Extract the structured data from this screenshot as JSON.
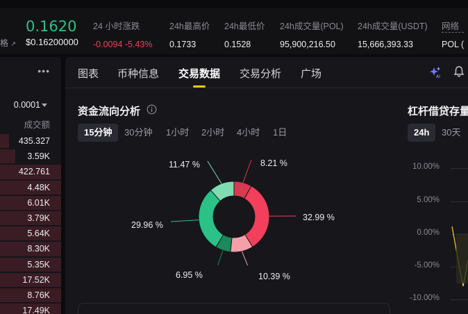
{
  "ticker": {
    "price": "0.1620",
    "price_usd": "$0.16200000",
    "left_cut_text": "格",
    "stats": [
      {
        "label": "24 小时涨跌",
        "value": "-0.0094 -5.43%",
        "tone": "red"
      },
      {
        "label": "24h最高价",
        "value": "0.1733",
        "tone": "normal"
      },
      {
        "label": "24h最低价",
        "value": "0.1528",
        "tone": "normal"
      },
      {
        "label": "24h成交量(POL)",
        "value": "95,900,216.50",
        "tone": "normal"
      },
      {
        "label": "24h成交量(USDT)",
        "value": "15,666,393.33",
        "tone": "normal"
      },
      {
        "label": "网络",
        "value": "POL (",
        "tone": "normal"
      }
    ]
  },
  "orderbook": {
    "more_icon": "more-dots-icon",
    "precision": "0.0001",
    "column_header": "成交额",
    "rows": [
      "435.327",
      "3.59K",
      "422.761",
      "4.48K",
      "6.01K",
      "3.79K",
      "5.64K",
      "8.30K",
      "5.35K",
      "17.52K",
      "8.76K",
      "17.49K"
    ],
    "depth": [
      0.15,
      0.25,
      1.0,
      1.0,
      1.0,
      1.0,
      1.0,
      1.0,
      1.0,
      1.0,
      1.0,
      1.0
    ]
  },
  "tabs": [
    "图表",
    "币种信息",
    "交易数据",
    "交易分析",
    "广场"
  ],
  "active_tab": 2,
  "fund_flow": {
    "title": "资金流向分析",
    "intervals": [
      "15分钟",
      "30分钟",
      "1小时",
      "2小时",
      "4小时",
      "1日"
    ],
    "active_interval": 0,
    "segments": [
      {
        "pct": 8.21,
        "label": "8.21 %",
        "color": "#d83a52"
      },
      {
        "pct": 32.99,
        "label": "32.99 %",
        "color": "#f23f5b"
      },
      {
        "pct": 10.39,
        "label": "10.39 %",
        "color": "#f5a0a8"
      },
      {
        "pct": 6.95,
        "label": "6.95 %",
        "color": "#1a8a5a"
      },
      {
        "pct": 29.96,
        "label": "29.96 %",
        "color": "#2bc287"
      },
      {
        "pct": 11.47,
        "label": "11.47 %",
        "color": "#7fdcb1"
      }
    ]
  },
  "margin": {
    "title": "杠杆借贷存量",
    "intervals": [
      "24h",
      "30天"
    ],
    "active_interval": 0,
    "y_ticks": [
      "10.00%",
      "5.00%",
      "0.00%",
      "-5.00%",
      "-10.00%"
    ]
  },
  "icons": {
    "ai": "ai-sparkle-icon",
    "bell": "bell-icon",
    "info": "info-icon"
  }
}
